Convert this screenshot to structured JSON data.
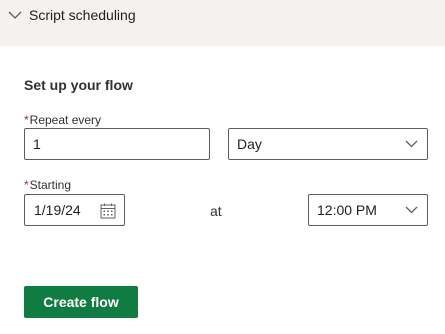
{
  "section": {
    "title": "Script scheduling",
    "expanded": true,
    "icon": "chevron-down-icon"
  },
  "flow": {
    "heading": "Set up your flow",
    "repeat": {
      "required_marker": "*",
      "label": "Repeat every",
      "value": "1",
      "unit_selected": "Day"
    },
    "starting": {
      "required_marker": "*",
      "label": "Starting",
      "date": "1/19/24",
      "at_label": "at",
      "time_selected": "12:00 PM"
    },
    "create_button_label": "Create flow"
  },
  "colors": {
    "page_background": "#f3f2f1",
    "card_background": "#ffffff",
    "primary_button": "#107c41",
    "required_marker": "#a4262c",
    "field_border": "#605e5c"
  }
}
